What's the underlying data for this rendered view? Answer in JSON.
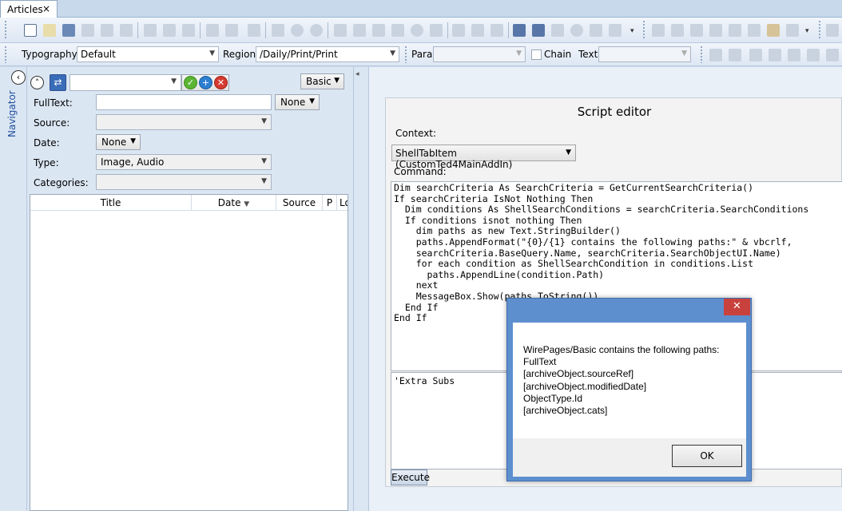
{
  "tabs": [
    {
      "label": "Articles",
      "close_icon": "×"
    }
  ],
  "toolbar2": {
    "typography_label": "Typography",
    "typography_value": "Default",
    "region_label": "Region",
    "region_value": "/Daily/Print/Print",
    "para_label": "Para",
    "chain_label": "Chain",
    "text_label": "Text"
  },
  "navigator": {
    "label": "Navigator",
    "collapse_icon": "‹"
  },
  "search": {
    "mode_value": "Basic",
    "fields": {
      "fulltext_label": "FullText:",
      "fulltext_mode": "None",
      "source_label": "Source:",
      "date_label": "Date:",
      "date_value": "None",
      "type_label": "Type:",
      "type_value": "Image, Audio",
      "categories_label": "Categories:"
    },
    "columns": [
      "Title",
      "Date",
      "Source",
      "P",
      "Lo"
    ],
    "sort_icon": "▼"
  },
  "script_editor": {
    "title": "Script editor",
    "context_label": "Context:",
    "context_value": "ShellTabItem (CustomTed4MainAddIn)",
    "command_label": "Command:",
    "code": "Dim searchCriteria As SearchCriteria = GetCurrentSearchCriteria()\nIf searchCriteria IsNot Nothing Then\n  Dim conditions As ShellSearchConditions = searchCriteria.SearchConditions\n  If conditions isnot nothing Then\n    dim paths as new Text.StringBuilder()\n    paths.AppendFormat(\"{0}/{1} contains the following paths:\" & vbcrlf,\n    searchCriteria.BaseQuery.Name, searchCriteria.SearchObjectUI.Name)\n    for each condition as ShellSearchCondition in conditions.List\n      paths.AppendLine(condition.Path)\n    next\n    MessageBox.Show(paths.ToString())\n  End If\nEnd If",
    "extra_code": "'Extra Subs",
    "execute_label": "Execute"
  },
  "message_box": {
    "close_icon": "✕",
    "lines": [
      "WirePages/Basic contains the following paths:",
      "FullText",
      "[archiveObject.sourceRef]",
      "[archiveObject.modifiedDate]",
      "ObjectType.Id",
      "[archiveObject.cats]"
    ],
    "ok_label": "OK"
  },
  "colors": {
    "accent": "#5d8fcf",
    "close_red": "#c9413c",
    "panel_bg": "#dbe6f3"
  }
}
